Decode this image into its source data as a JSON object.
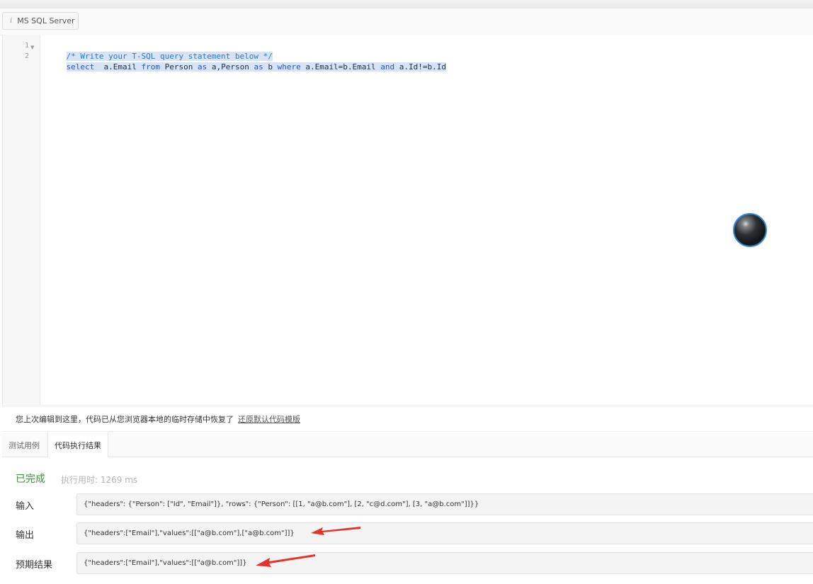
{
  "language_button": {
    "icon": "info-icon",
    "label": "MS SQL Server"
  },
  "editor": {
    "line_numbers": [
      "1",
      "2"
    ],
    "comment": "/* Write your T-SQL query statement below */",
    "query_tokens": [
      {
        "t": "select",
        "k": "kw"
      },
      {
        "t": "  a.Email ",
        "k": "id"
      },
      {
        "t": "from",
        "k": "kw"
      },
      {
        "t": " Person ",
        "k": "id"
      },
      {
        "t": "as",
        "k": "kw"
      },
      {
        "t": " a,Person ",
        "k": "id"
      },
      {
        "t": "as",
        "k": "kw"
      },
      {
        "t": " b ",
        "k": "id"
      },
      {
        "t": "where",
        "k": "kw"
      },
      {
        "t": " a.Email=b.Email ",
        "k": "id"
      },
      {
        "t": "and",
        "k": "kw"
      },
      {
        "t": " a.Id!=b.Id",
        "k": "id"
      }
    ]
  },
  "restore": {
    "message": "您上次编辑到这里，代码已从您浏览器本地的临时存储中恢复了",
    "link": "还原默认代码模版"
  },
  "tabs": [
    {
      "label": "测试用例",
      "active": false
    },
    {
      "label": "代码执行结果",
      "active": true
    }
  ],
  "result": {
    "status": "已完成",
    "elapsed": "执行用时: 1269 ms",
    "input_label": "输入",
    "input_value": "{\"headers\": {\"Person\": [\"Id\", \"Email\"]}, \"rows\": {\"Person\": [[1, \"a@b.com\"], [2, \"c@d.com\"], [3, \"a@b.com\"]]}}",
    "output_label": "输出",
    "output_value": "{\"headers\":[\"Email\"],\"values\":[[\"a@b.com\"],[\"a@b.com\"]]}",
    "expected_label": "预期结果",
    "expected_value": "{\"headers\":[\"Email\"],\"values\":[[\"a@b.com\"]]}"
  },
  "colors": {
    "status_green": "#3f8f3f",
    "annotation_arrow": "#e8312a",
    "keyword_blue": "#2b55c6",
    "selection": "#d7e3f7"
  }
}
